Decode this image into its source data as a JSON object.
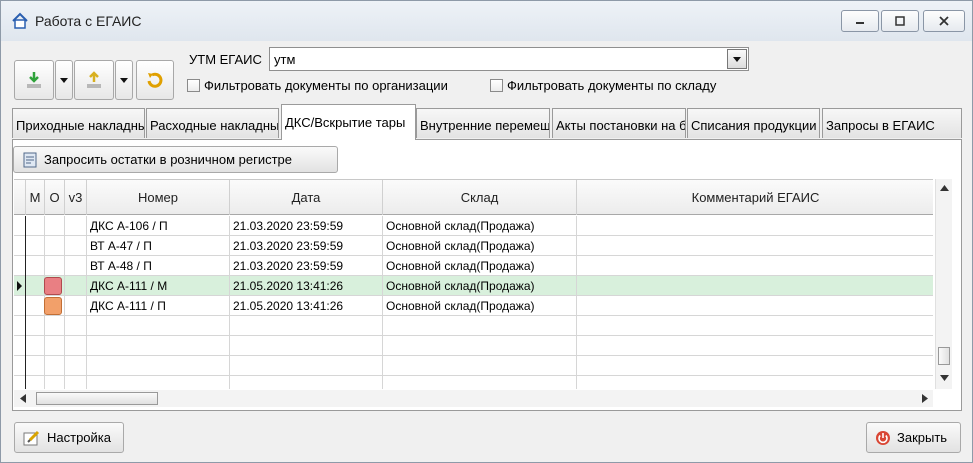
{
  "window": {
    "title": "Работа с ЕГАИС",
    "icon": "house-icon"
  },
  "toolbar": {
    "import_icon": "download-arrow-icon",
    "export_icon": "upload-arrow-icon",
    "refresh_icon": "refresh-icon"
  },
  "utm": {
    "label": "УТМ ЕГАИС",
    "value": "утм"
  },
  "filters": {
    "by_org": "Фильтровать документы по организации",
    "by_store": "Фильтровать документы по складу"
  },
  "tabs": [
    {
      "label": "Приходные накладные"
    },
    {
      "label": "Расходные накладные"
    },
    {
      "label": "ДКС/Вскрытие тары"
    },
    {
      "label": "Внутренние перемещения"
    },
    {
      "label": "Акты постановки на баланс"
    },
    {
      "label": "Списания продукции"
    },
    {
      "label": "Запросы в ЕГАИС"
    }
  ],
  "request_button": {
    "label": "Запросить остатки в розничном регистре",
    "icon": "register-icon"
  },
  "table": {
    "columns": [
      "М",
      "О",
      "v3",
      "Номер",
      "Дата",
      "Склад",
      "Комментарий ЕГАИС"
    ],
    "rows": [
      {
        "number": "ДКС А-106 / П",
        "date": "21.03.2020 23:59:59",
        "store": "Основной склад(Продажа)",
        "comment": "",
        "status": ""
      },
      {
        "number": "ВТ А-47 / П",
        "date": "21.03.2020 23:59:59",
        "store": "Основной склад(Продажа)",
        "comment": "",
        "status": ""
      },
      {
        "number": "ВТ А-48 / П",
        "date": "21.03.2020 23:59:59",
        "store": "Основной склад(Продажа)",
        "comment": "",
        "status": ""
      },
      {
        "number": "ДКС А-111 / М",
        "date": "21.05.2020 13:41:26",
        "store": "Основной склад(Продажа)",
        "comment": "",
        "status": "#e97f83"
      },
      {
        "number": "ДКС А-111 / П",
        "date": "21.05.2020 13:41:26",
        "store": "Основной склад(Продажа)",
        "comment": "",
        "status": "#f2a06a"
      }
    ],
    "selected_row": 3
  },
  "footer": {
    "settings_label": "Настройка",
    "settings_icon": "settings-icon",
    "close_label": "Закрыть",
    "close_icon": "power-icon"
  },
  "colors": {
    "selected_row": "#d8f0dc",
    "status_red": "#e97f83",
    "status_orange": "#f2a06a"
  }
}
